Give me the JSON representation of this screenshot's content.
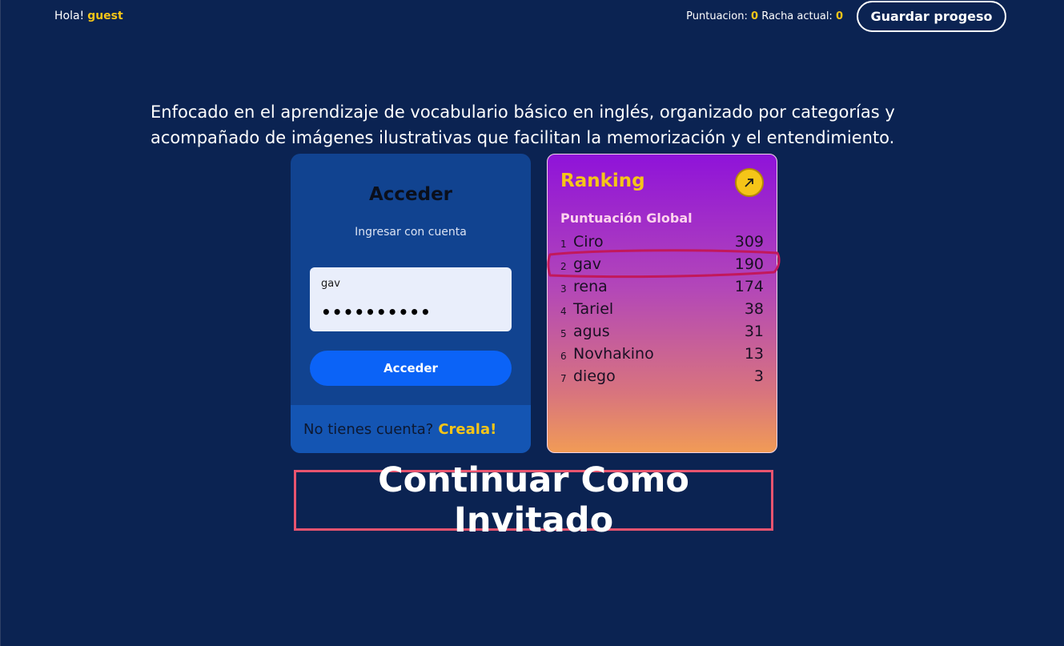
{
  "header": {
    "greeting": "Hola!",
    "username": "guest",
    "score_label": "Puntuacion:",
    "score_value": "0",
    "streak_label": "Racha actual:",
    "streak_value": "0",
    "save_button": "Guardar progeso"
  },
  "intro_text": "Enfocado en el aprendizaje de vocabulario básico en inglés, organizado por categorías y acompañado de imágenes ilustrativas que facilitan la memorización y el entendimiento.",
  "login": {
    "title": "Acceder",
    "subtitle": "Ingresar con cuenta",
    "username_value": "gav",
    "password_mask": "••••••••••",
    "submit_label": "Acceder",
    "no_account_text": "No tienes cuenta?",
    "create_link": "Creala!"
  },
  "ranking": {
    "title": "Ranking",
    "subtitle": "Puntuación Global",
    "open_icon": "arrow-up-right-icon",
    "entries": [
      {
        "pos": "1",
        "name": "Ciro",
        "score": "309"
      },
      {
        "pos": "2",
        "name": "gav",
        "score": "190"
      },
      {
        "pos": "3",
        "name": "rena",
        "score": "174"
      },
      {
        "pos": "4",
        "name": "Tariel",
        "score": "38"
      },
      {
        "pos": "5",
        "name": "agus",
        "score": "31"
      },
      {
        "pos": "6",
        "name": "Novhakino",
        "score": "13"
      },
      {
        "pos": "7",
        "name": "diego",
        "score": "3"
      }
    ]
  },
  "guest_button": "Continuar Como Invitado",
  "colors": {
    "background": "#0b2352",
    "accent": "#f5c518",
    "primary_button": "#0b63f7",
    "highlight_outline": "#c2185b",
    "guest_border": "#e8546f"
  }
}
